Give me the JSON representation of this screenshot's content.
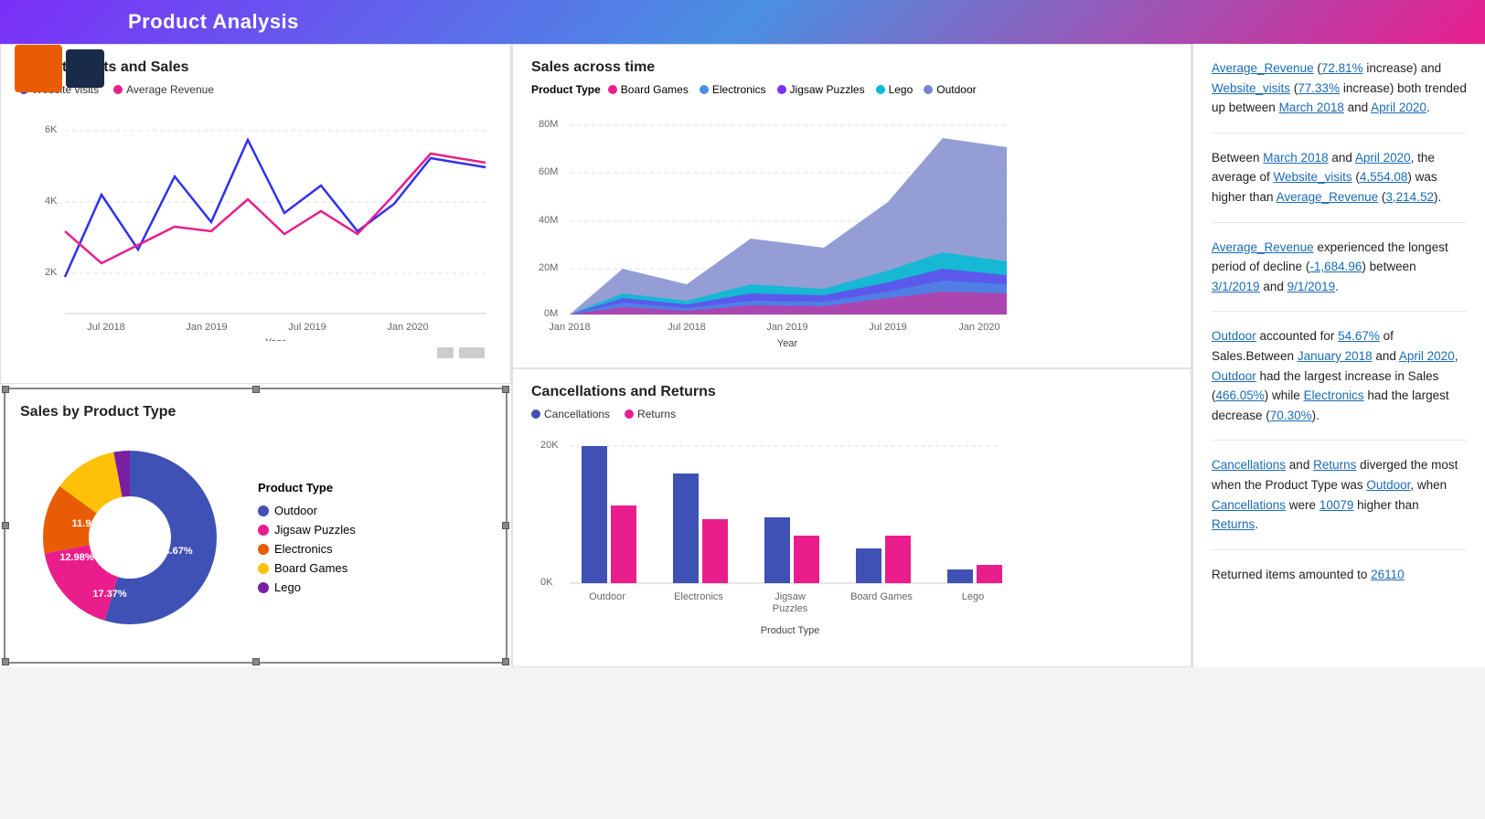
{
  "header": {
    "title": "Product Analysis"
  },
  "websiteVisitsChart": {
    "title": "Website visits and Sales",
    "legend": [
      {
        "label": "Website visits",
        "color": "#3030f0"
      },
      {
        "label": "Average Revenue",
        "color": "#e91e8c"
      }
    ],
    "xLabels": [
      "Jul 2018",
      "Jan 2019",
      "Jul 2019",
      "Jan 2020"
    ],
    "xAxisLabel": "Year",
    "yLabels": [
      "6K",
      "4K",
      "2K"
    ],
    "websiteData": [
      2500,
      4500,
      3000,
      5200,
      3800,
      5800,
      3900,
      4800,
      3200,
      4200,
      5400,
      5100
    ],
    "revenueData": [
      3200,
      2400,
      2800,
      3400,
      3200,
      4200,
      3100,
      3800,
      3200,
      4500,
      5400,
      5200
    ]
  },
  "salesAcrossTime": {
    "title": "Sales across time",
    "legendTitle": "Product Type",
    "legend": [
      {
        "label": "Board Games",
        "color": "#e91e8c"
      },
      {
        "label": "Electronics",
        "color": "#4a90e2"
      },
      {
        "label": "Jigsaw Puzzles",
        "color": "#7b2ff7"
      },
      {
        "label": "Lego",
        "color": "#00bcd4"
      },
      {
        "label": "Outdoor",
        "color": "#7986cb"
      }
    ],
    "yLabels": [
      "80M",
      "60M",
      "40M",
      "20M",
      "0M"
    ],
    "xLabels": [
      "Jan 2018",
      "Jul 2018",
      "Jan 2019",
      "Jul 2019",
      "Jan 2020"
    ],
    "xAxisLabel": "Year"
  },
  "salesByProductType": {
    "title": "Sales by Product Type",
    "legendTitle": "Product Type",
    "segments": [
      {
        "label": "Outdoor",
        "color": "#3f51b5",
        "pct": 54.67
      },
      {
        "label": "Jigsaw Puzzles",
        "color": "#e91e8c",
        "pct": 17.37
      },
      {
        "label": "Electronics",
        "color": "#e85d04",
        "pct": 12.98
      },
      {
        "label": "Board Games",
        "color": "#ffc107",
        "pct": 11.96
      },
      {
        "label": "Lego",
        "color": "#7b1fa2",
        "pct": 3.02
      }
    ]
  },
  "cancellationsReturns": {
    "title": "Cancellations and Returns",
    "legend": [
      {
        "label": "Cancellations",
        "color": "#3f51b5"
      },
      {
        "label": "Returns",
        "color": "#e91e8c"
      }
    ],
    "xAxisLabel": "Product Type",
    "yLabels": [
      "20K",
      "0K"
    ],
    "bars": [
      {
        "label": "Outdoor",
        "cancellations": 0.95,
        "returns": 0.55
      },
      {
        "label": "Electronics",
        "cancellations": 0.68,
        "returns": 0.42
      },
      {
        "label": "Jigsaw\nPuzzles",
        "cancellations": 0.42,
        "returns": 0.3
      },
      {
        "label": "Board Games",
        "cancellations": 0.22,
        "returns": 0.32
      },
      {
        "label": "Lego",
        "cancellations": 0.08,
        "returns": 0.11
      }
    ]
  },
  "insights": [
    {
      "text": "Average_Revenue (72.81% increase) and Website_visits (77.33% increase) both trended up between March 2018 and April 2020.",
      "links": [
        "Average_Revenue",
        "72.81%",
        "Website_visits",
        "77.33%",
        "March 2018",
        "April 2020"
      ]
    },
    {
      "text": "Between March 2018 and April 2020, the average of Website_visits (4,554.08) was higher than Average_Revenue (3,214.52).",
      "links": [
        "March 2018",
        "April 2020",
        "Website_visits",
        "4,554.08",
        "Average_Revenue",
        "3,214.52"
      ]
    },
    {
      "text": "Average_Revenue experienced the longest period of decline (-1,684.96) between 3/1/2019 and 9/1/2019.",
      "links": [
        "Average_Revenue",
        "-1,684.96",
        "3/1/2019",
        "9/1/2019"
      ]
    },
    {
      "text": "Outdoor accounted for 54.67% of Sales.Between January 2018 and April 2020, Outdoor had the largest increase in Sales (466.05%) while Electronics had the largest decrease (70.30%).",
      "links": [
        "Outdoor",
        "54.67%",
        "January 2018",
        "April 2020",
        "Outdoor",
        "466.05%",
        "Electronics",
        "70.30%"
      ]
    },
    {
      "text": "Cancellations and Returns diverged the most when the Product Type was Outdoor, when Cancellations were 10079 higher than Returns.",
      "links": [
        "Cancellations",
        "Returns",
        "Outdoor",
        "Cancellations",
        "10079",
        "Returns"
      ]
    },
    {
      "text": "Returned items amounted to 26110",
      "links": [
        "26110"
      ]
    }
  ]
}
